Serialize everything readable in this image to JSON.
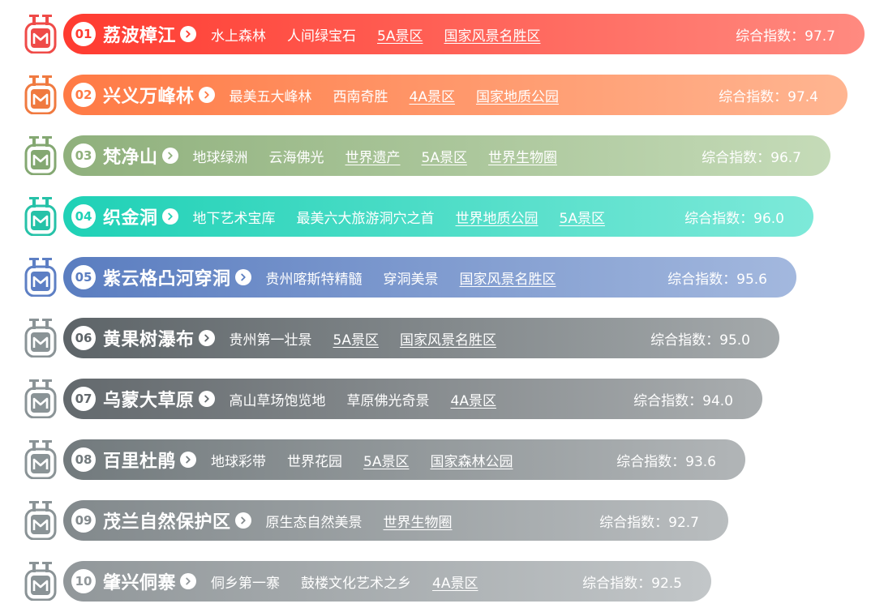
{
  "score_label": "综合指数：",
  "icons": {
    "badge": "ranking-medal-icon",
    "go": "chevron-right-icon"
  },
  "items": [
    {
      "rank": "01",
      "name": "荔波樟江",
      "tags": [
        {
          "text": "水上森林",
          "link": false
        },
        {
          "text": "人间绿宝石",
          "link": false
        },
        {
          "text": "5A景区",
          "link": true
        },
        {
          "text": "国家风景名胜区",
          "link": true
        }
      ],
      "score": "97.7",
      "color_start": "#ff3b30",
      "color_end": "#ff8a80",
      "badge_color": "#ef4b48"
    },
    {
      "rank": "02",
      "name": "兴义万峰林",
      "tags": [
        {
          "text": "最美五大峰林",
          "link": false
        },
        {
          "text": "西南奇胜",
          "link": false
        },
        {
          "text": "4A景区",
          "link": true
        },
        {
          "text": "国家地质公园",
          "link": true
        }
      ],
      "score": "97.4",
      "color_start": "#ff7a45",
      "color_end": "#ffb591",
      "badge_color": "#f07a40"
    },
    {
      "rank": "03",
      "name": "梵净山",
      "tags": [
        {
          "text": "地球绿洲",
          "link": false
        },
        {
          "text": "云海佛光",
          "link": false
        },
        {
          "text": "世界遗产",
          "link": true
        },
        {
          "text": "5A景区",
          "link": true
        },
        {
          "text": "世界生物圈",
          "link": true
        }
      ],
      "score": "96.7",
      "color_start": "#8fb07c",
      "color_end": "#c5dbb8",
      "badge_color": "#84a872"
    },
    {
      "rank": "04",
      "name": "织金洞",
      "tags": [
        {
          "text": "地下艺术宝库",
          "link": false
        },
        {
          "text": "最美六大旅游洞穴之首",
          "link": false
        },
        {
          "text": "世界地质公园",
          "link": true
        },
        {
          "text": "5A景区",
          "link": true
        }
      ],
      "score": "96.0",
      "color_start": "#1fd1b6",
      "color_end": "#7de9d9",
      "badge_color": "#26c2a8"
    },
    {
      "rank": "05",
      "name": "紫云格凸河穿洞",
      "tags": [
        {
          "text": "贵州喀斯特精髓",
          "link": false
        },
        {
          "text": "穿洞美景",
          "link": false
        },
        {
          "text": "国家风景名胜区",
          "link": true
        }
      ],
      "score": "95.6",
      "color_start": "#5a7dc0",
      "color_end": "#a3b8de",
      "badge_color": "#5d7fc4"
    },
    {
      "rank": "06",
      "name": "黄果树瀑布",
      "tags": [
        {
          "text": "贵州第一壮景",
          "link": false
        },
        {
          "text": "5A景区",
          "link": true
        },
        {
          "text": "国家风景名胜区",
          "link": true
        }
      ],
      "score": "95.0",
      "color_start": "#5d6468",
      "color_end": "#a4a9ab",
      "badge_color": "#8a9396"
    },
    {
      "rank": "07",
      "name": "乌蒙大草原",
      "tags": [
        {
          "text": "高山草场饱览地",
          "link": false
        },
        {
          "text": "草原佛光奇景",
          "link": false
        },
        {
          "text": "4A景区",
          "link": true
        }
      ],
      "score": "94.0",
      "color_start": "#63696d",
      "color_end": "#a9adaf",
      "badge_color": "#8a9396"
    },
    {
      "rank": "08",
      "name": "百里杜鹃",
      "tags": [
        {
          "text": "地球彩带",
          "link": false
        },
        {
          "text": "世界花园",
          "link": false
        },
        {
          "text": "5A景区",
          "link": true
        },
        {
          "text": "国家森林公园",
          "link": true
        }
      ],
      "score": "93.6",
      "color_start": "#727a7d",
      "color_end": "#b1b5b7",
      "badge_color": "#8a9396"
    },
    {
      "rank": "09",
      "name": "茂兰自然保护区",
      "tags": [
        {
          "text": "原生态自然美景",
          "link": false
        },
        {
          "text": "世界生物圈",
          "link": true
        }
      ],
      "score": "92.7",
      "color_start": "#82898c",
      "color_end": "#b9bdbf",
      "badge_color": "#8a9396"
    },
    {
      "rank": "10",
      "name": "肇兴侗寨",
      "tags": [
        {
          "text": "侗乡第一寨",
          "link": false
        },
        {
          "text": "鼓楼文化艺术之乡",
          "link": false
        },
        {
          "text": "4A景区",
          "link": true
        }
      ],
      "score": "92.5",
      "color_start": "#91979a",
      "color_end": "#c2c6c8",
      "badge_color": "#8a9396"
    }
  ]
}
